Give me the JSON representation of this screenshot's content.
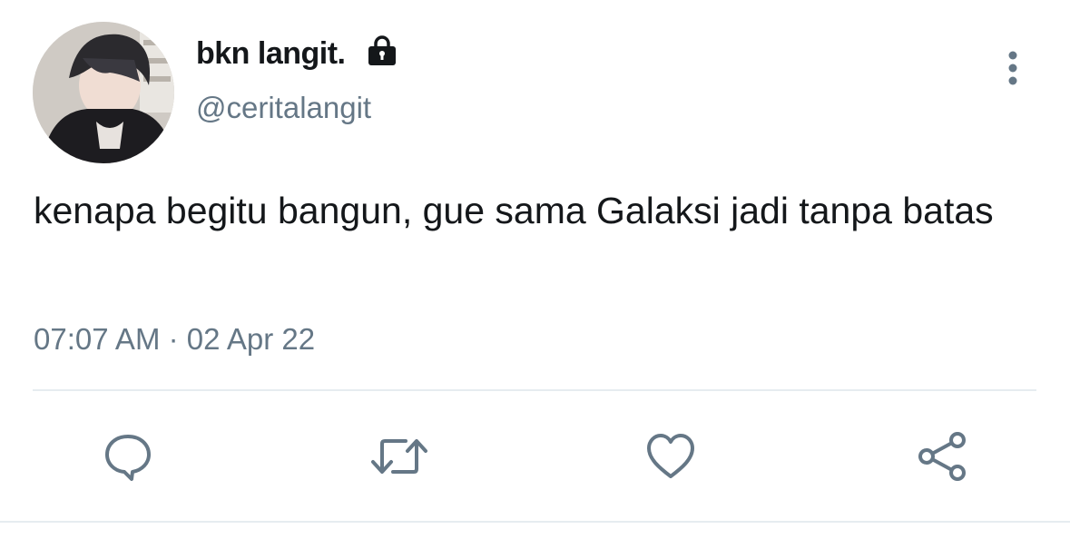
{
  "tweet": {
    "display_name": "bkn langit.",
    "handle": "@ceritalangit",
    "text": "kenapa begitu bangun, gue sama Galaksi jadi tanpa batas",
    "time": "07:07 AM",
    "separator": "·",
    "date": "02 Apr 22",
    "protected": true
  },
  "icons": {
    "lock": "lock-icon",
    "more": "more-vertical-icon",
    "reply": "reply-icon",
    "retweet": "retweet-icon",
    "like": "heart-icon",
    "share": "share-icon"
  },
  "colors": {
    "text": "#14171a",
    "secondary": "#657786",
    "divider": "#e6ecf0"
  }
}
